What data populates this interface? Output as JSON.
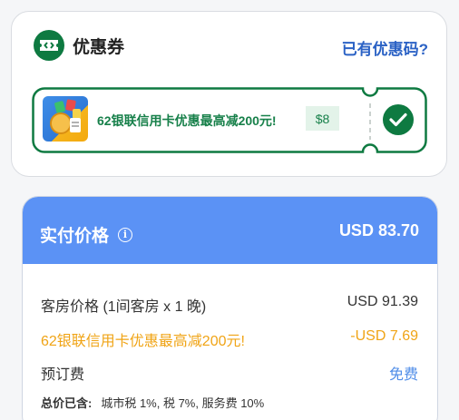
{
  "coupon": {
    "title": "优惠券",
    "have_code_link": "已有优惠码?",
    "item": {
      "text": "62银联信用卡优惠最高减200元!",
      "amount": "$8",
      "selected": true
    },
    "icons": {
      "header": "ticket-icon",
      "check": "check-icon"
    },
    "colors": {
      "green": "#0e7a41",
      "link": "#2b62c5"
    }
  },
  "price": {
    "title": "实付价格",
    "total": "USD 83.70",
    "rows": [
      {
        "label": "客房价格 (1间客房 x 1 晚)",
        "value": "USD 91.39"
      },
      {
        "label": "62银联信用卡优惠最高减200元!",
        "value": "-USD 7.69"
      },
      {
        "label": "预订费",
        "value": "免费"
      }
    ],
    "tax_label": "总价已含:",
    "tax_value": "城市税 1%, 税 7%, 服务费 10%",
    "colors": {
      "header": "#5b92f5",
      "discount": "#f0a416",
      "free": "#4f8de8"
    }
  }
}
